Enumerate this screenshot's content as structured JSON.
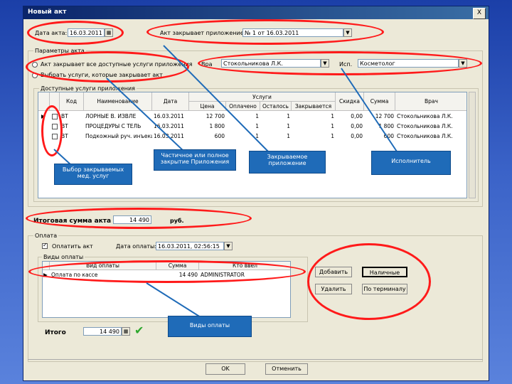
{
  "window": {
    "title": "Новый акт",
    "close": "X"
  },
  "header": {
    "date_label": "Дата акта:",
    "date_value": "16.03.2011",
    "closes_label": "Акт закрывает приложение:",
    "closes_value": "№ 1 от 16.03.2011"
  },
  "params": {
    "title": "Параметры акта",
    "radio1": "Акт закрывает все доступные услуги приложения",
    "radio2": "Выбрать услуги, которые закрывает акт",
    "doctor_label": "Вра",
    "doctor_value": "Стокольникова Л.К.",
    "performer_label": "Исп.",
    "performer_value": "Косметолог"
  },
  "services": {
    "group_title": "Доступные услуги приложения",
    "headers": {
      "code": "Код",
      "name": "Наименование",
      "date": "Дата",
      "group": "Услуги",
      "price": "Цена",
      "planned": "Оплачено",
      "remaining": "Осталось",
      "closing": "Закрывается",
      "discount": "Скидка",
      "sum": "Сумма",
      "doctor": "Врач"
    },
    "rows": [
      {
        "code": "ВТ",
        "name": "ЛОРНЫЕ В. ИЗВЛЕ",
        "date": "16.03.2011",
        "price": "12 700",
        "planned": "1",
        "remaining": "1",
        "closing": "1",
        "discount": "0,00",
        "sum": "12 700",
        "doctor": "Стокольникова Л.К."
      },
      {
        "code": "ВТ",
        "name": "ПРОЦЕДУРЫ С ТЕЛЬ",
        "date": "16.03.2011",
        "price": "1 800",
        "planned": "1",
        "remaining": "1",
        "closing": "1",
        "discount": "0,00",
        "sum": "1 800",
        "doctor": "Стокольникова Л.К."
      },
      {
        "code": "ВТ",
        "name": "Подкожный руч. инъекц.",
        "date": "16.03.2011",
        "price": "600",
        "planned": "1",
        "remaining": "1",
        "closing": "1",
        "discount": "0,00",
        "sum": "600",
        "doctor": "Стокольникова Л.К."
      }
    ]
  },
  "total": {
    "label": "Итоговая сумма акта",
    "value": "14 490",
    "unit": "руб."
  },
  "payment": {
    "group_title": "Оплата",
    "pay_label": "Оплатить акт",
    "paydate_label": "Дата оплаты:",
    "paydate_value": "16.03.2011, 02:56:15",
    "types_title": "Виды оплаты",
    "headers": {
      "type": "Вид оплаты",
      "sum": "Сумма",
      "user": "Кто ввел"
    },
    "rows": [
      {
        "type": "Оплата по кассе",
        "sum": "14 490",
        "user": "ADMINISTRATOR"
      }
    ],
    "add": "Добавить",
    "cash": "Наличные",
    "delete": "Удалить",
    "card": "По терминалу",
    "itogo_label": "Итого",
    "itogo_value": "14 490"
  },
  "footer": {
    "ok": "OK",
    "cancel": "Отменить"
  },
  "callouts": {
    "select_services": "Выбор закрываемых мед. услуг",
    "partial_full": "Частичное или полное закрытие Приложения",
    "closed_app": "Закрываемое приложение",
    "performer": "Исполнитель",
    "pay_types": "Виды оплаты"
  }
}
